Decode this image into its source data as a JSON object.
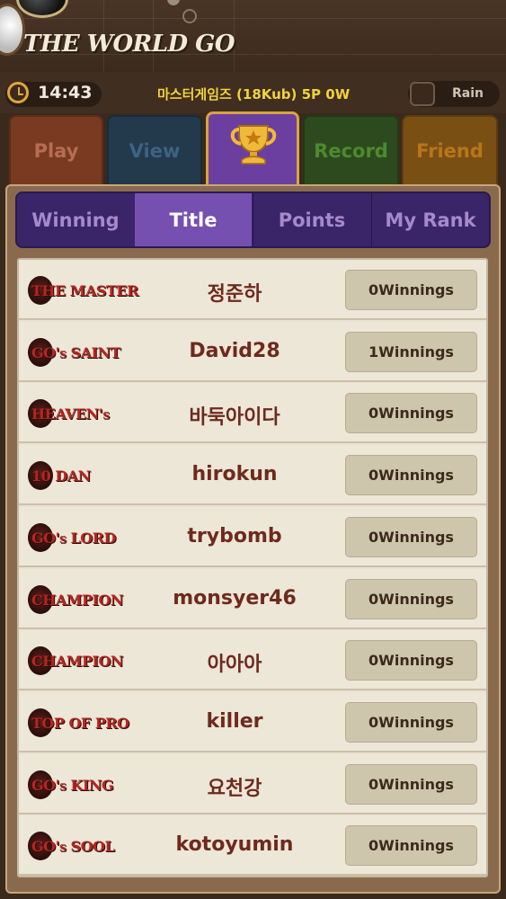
{
  "app": {
    "logo_text": "THE WORLD GO"
  },
  "status_bar": {
    "time": "14:43",
    "user_info": "마스터게임즈 (18Kub) 5P 0W",
    "rain_label": "Rain"
  },
  "main_tabs": [
    {
      "label": "Play"
    },
    {
      "label": "View"
    },
    {
      "label": "",
      "icon": "trophy-icon"
    },
    {
      "label": "Record"
    },
    {
      "label": "Friend"
    }
  ],
  "sub_tabs": [
    {
      "label": "Winning"
    },
    {
      "label": "Title",
      "active": true
    },
    {
      "label": "Points"
    },
    {
      "label": "My Rank"
    }
  ],
  "rows": [
    {
      "title": "THE MASTER",
      "name": "정준하",
      "winnings": "0Winnings"
    },
    {
      "title": "GO's SAINT",
      "name": "David28",
      "winnings": "1Winnings"
    },
    {
      "title": "HEAVEN's",
      "name": "바둑아이다",
      "winnings": "0Winnings"
    },
    {
      "title": "10 DAN",
      "name": "hirokun",
      "winnings": "0Winnings"
    },
    {
      "title": "GO's LORD",
      "name": "trybomb",
      "winnings": "0Winnings"
    },
    {
      "title": "CHAMPION",
      "name": "monsyer46",
      "winnings": "0Winnings"
    },
    {
      "title": "CHAMPION",
      "name": "아아아",
      "winnings": "0Winnings"
    },
    {
      "title": "TOP OF PRO",
      "name": "killer",
      "winnings": "0Winnings"
    },
    {
      "title": "GO's KING",
      "name": "요천강",
      "winnings": "0Winnings"
    },
    {
      "title": "GO's SOOL",
      "name": "kotoyumin",
      "winnings": "0Winnings"
    }
  ],
  "colors": {
    "active_tab": "#7550b1",
    "title_badge_red": "#b6261e",
    "name_brown": "#6e2a1c",
    "clock_orange": "#e0a53c",
    "user_yellow": "#f2d23a"
  }
}
